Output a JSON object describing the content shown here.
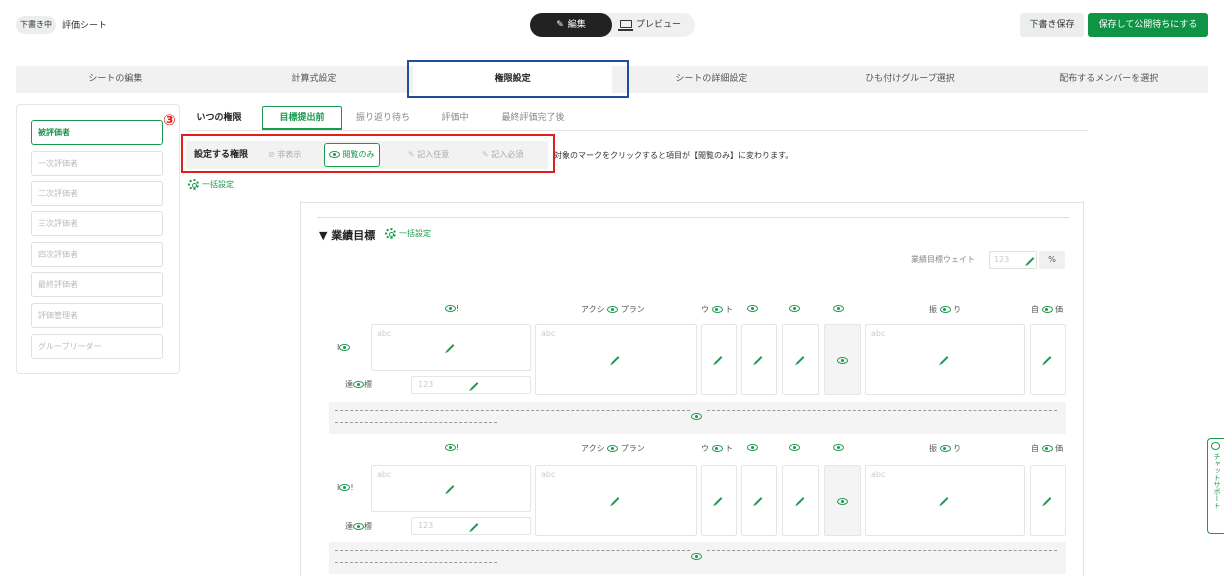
{
  "header": {
    "status_badge": "下書き中",
    "sheet_title": "評価シート",
    "mode_edit": "編集",
    "mode_preview": "プレビュー",
    "save_draft": "下書き保存",
    "save_publish": "保存して公開待ちにする"
  },
  "steps": [
    "シートの編集",
    "計算式設定",
    "権限設定",
    "シートの詳細設定",
    "ひも付けグループ選択",
    "配布するメンバーを選択"
  ],
  "active_step": "権限設定",
  "sidebar": {
    "items": [
      "被評価者",
      "一次評価者",
      "二次評価者",
      "三次評価者",
      "四次評価者",
      "最終評価者",
      "評価管理者",
      "グループリーダー"
    ],
    "active": "被評価者"
  },
  "annotation": {
    "marker": "③",
    "color": "#e0201d",
    "highlight_color": "#1f4f9a"
  },
  "timing": {
    "label": "いつの権限",
    "tabs": [
      "目標提出前",
      "振り返り待ち",
      "評価中",
      "最終評価完了後"
    ],
    "active": "目標提出前"
  },
  "permission": {
    "label": "設定する権限",
    "options": [
      "非表示",
      "閲覧のみ",
      "記入任意",
      "記入必須"
    ],
    "active": "閲覧のみ",
    "note": "対象のマークをクリックすると項目が【閲覧のみ】に変わります。"
  },
  "bulk_label": "一括設定",
  "section": {
    "title": "▼ 業績目標",
    "bulk_label": "一括設定",
    "weight_label": "業績目標ウェイト",
    "weight_placeholder": "123",
    "weight_unit": "%"
  },
  "columns": {
    "target_prefix": "",
    "target_suffix": "!",
    "action_prefix": "アクシ",
    "action_suffix": "プラン",
    "weight_prefix": "ウ",
    "weight_suffix": "ト",
    "c5_prefix": "",
    "c5_suffix": "",
    "c6_prefix": "",
    "c6_suffix": "",
    "c7_prefix": "",
    "c7_suffix": "",
    "review_prefix": "振",
    "review_suffix": "り",
    "self_prefix": "自",
    "self_suffix": "価"
  },
  "rows": [
    {
      "label_prefix": "I",
      "label_suffix": "",
      "text_placeholder": "abc",
      "progress_prefix": "達",
      "progress_suffix": "標",
      "progress_placeholder": "123"
    },
    {
      "label_prefix": "I",
      "label_suffix": "!",
      "text_placeholder": "abc",
      "progress_prefix": "達",
      "progress_suffix": "標",
      "progress_placeholder": "123"
    }
  ],
  "chat_support": "チャットサポート",
  "colors": {
    "green": "#0f9345",
    "accent_green": "#1a9a4e",
    "red": "#e0201d",
    "blue": "#1f4f9a"
  }
}
